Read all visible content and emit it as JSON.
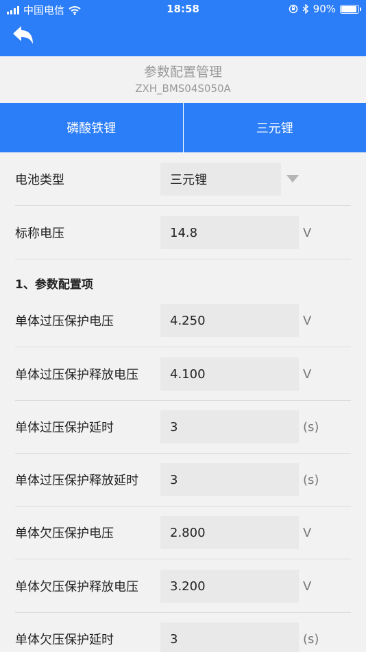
{
  "status_bar": {
    "carrier": "中国电信",
    "time": "18:58",
    "battery_percent": "90%",
    "battery_level": 0.9
  },
  "header": {
    "title": "参数配置管理",
    "device_id": "ZXH_BMS04S050A"
  },
  "tabs": [
    {
      "label": "磷酸铁锂"
    },
    {
      "label": "三元锂"
    }
  ],
  "battery_type": {
    "label": "电池类型",
    "value": "三元锂"
  },
  "nominal_voltage": {
    "label": "标称电压",
    "value": "14.8",
    "unit": "V"
  },
  "section_title": "1、参数配置项",
  "params": [
    {
      "label": "单体过压保护电压",
      "value": "4.250",
      "unit": "V"
    },
    {
      "label": "单体过压保护释放电压",
      "value": "4.100",
      "unit": "V"
    },
    {
      "label": "单体过压保护延时",
      "value": "3",
      "unit": "(s)"
    },
    {
      "label": "单体过压保护释放延时",
      "value": "3",
      "unit": "(s)"
    },
    {
      "label": "单体欠压保护电压",
      "value": "2.800",
      "unit": "V"
    },
    {
      "label": "单体欠压保护释放电压",
      "value": "3.200",
      "unit": "V"
    },
    {
      "label": "单体欠压保护延时",
      "value": "3",
      "unit": "(s)"
    }
  ],
  "colors": {
    "accent": "#2c7ef8",
    "background": "#f2f2f2",
    "field": "#e9e9e9"
  },
  "icons": [
    "signal-icon",
    "wifi-icon",
    "orientation-lock-icon",
    "bluetooth-icon",
    "battery-icon",
    "back-arrow-icon"
  ]
}
